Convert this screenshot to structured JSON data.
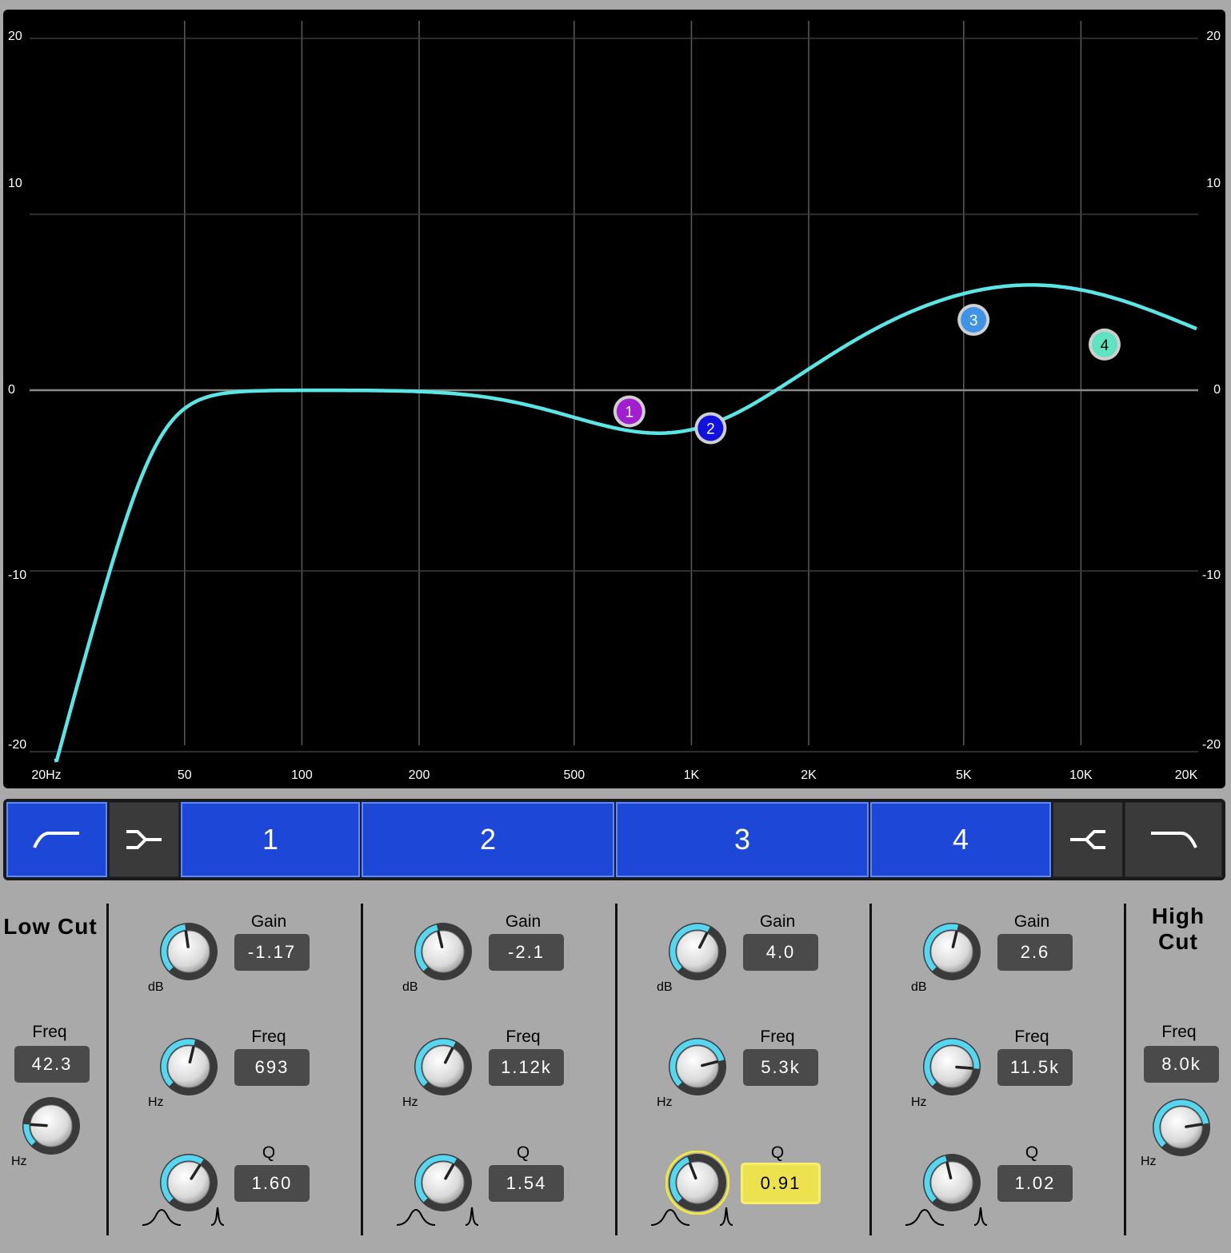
{
  "graph": {
    "db_left": [
      "20",
      "10",
      "0",
      "-10",
      "-20"
    ],
    "db_right": [
      "20",
      "10",
      "0",
      "-10",
      "-20"
    ],
    "freq_labels": [
      "20Hz",
      "50",
      "100",
      "200",
      "500",
      "1K",
      "2K",
      "5K",
      "10K",
      "20K"
    ],
    "curve_color": "#5be6e6",
    "nodes": [
      {
        "label": "1",
        "freq": 693,
        "gain": -1.17,
        "color": "#a21fd0"
      },
      {
        "label": "2",
        "freq": 1120,
        "gain": -2.1,
        "color": "#1212e0"
      },
      {
        "label": "3",
        "freq": 5300,
        "gain": 4.0,
        "color": "#3f93e6"
      },
      {
        "label": "4",
        "freq": 11500,
        "gain": 2.6,
        "color": "#5fe3c0"
      }
    ]
  },
  "band_bar": {
    "low_cut_icon": "low-cut-shape-icon",
    "low_shelf_icon": "low-shelf-shape-icon",
    "bands": [
      "1",
      "2",
      "3",
      "4"
    ],
    "high_shelf_icon": "high-shelf-shape-icon",
    "high_cut_icon": "high-cut-shape-icon",
    "active_color": "#1d47d6"
  },
  "low_cut": {
    "title": "Low Cut",
    "freq_label": "Freq",
    "freq_value": "42.3",
    "unit": "Hz"
  },
  "high_cut": {
    "title_line1": "High",
    "title_line2": "Cut",
    "freq_label": "Freq",
    "freq_value": "8.0k",
    "unit": "Hz"
  },
  "bands": [
    {
      "gain_label": "Gain",
      "gain": "-1.17",
      "gain_unit": "dB",
      "freq_label": "Freq",
      "freq": "693",
      "freq_unit": "Hz",
      "q_label": "Q",
      "q": "1.60"
    },
    {
      "gain_label": "Gain",
      "gain": "-2.1",
      "gain_unit": "dB",
      "freq_label": "Freq",
      "freq": "1.12k",
      "freq_unit": "Hz",
      "q_label": "Q",
      "q": "1.54"
    },
    {
      "gain_label": "Gain",
      "gain": "4.0",
      "gain_unit": "dB",
      "freq_label": "Freq",
      "freq": "5.3k",
      "freq_unit": "Hz",
      "q_label": "Q",
      "q": "0.91"
    },
    {
      "gain_label": "Gain",
      "gain": "2.6",
      "gain_unit": "dB",
      "freq_label": "Freq",
      "freq": "11.5k",
      "freq_unit": "Hz",
      "q_label": "Q",
      "q": "1.02"
    }
  ],
  "knob_levels": {
    "low_cut_freq": 0.18,
    "high_cut_freq": 0.8,
    "band_gain": [
      0.47,
      0.45,
      0.6,
      0.55
    ],
    "band_freq": [
      0.55,
      0.6,
      0.78,
      0.85
    ],
    "band_q": [
      0.62,
      0.61,
      0.42,
      0.45
    ]
  },
  "selected_control": "band-3-q"
}
